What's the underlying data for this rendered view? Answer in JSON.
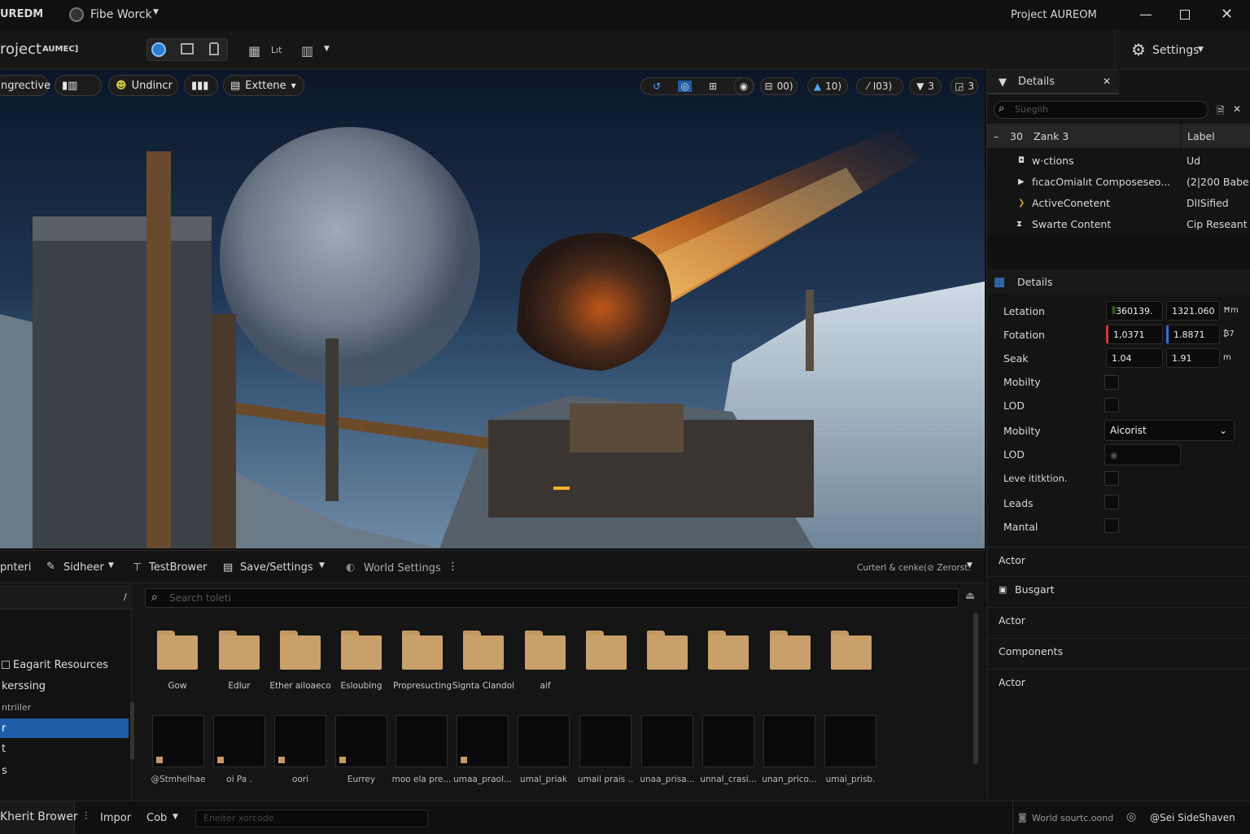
{
  "titlebar": {
    "app_name": "UREDM",
    "menu": "Fibe Worck",
    "project": "Project AUREOM"
  },
  "toolbar": {
    "project_label": "roject",
    "project_tag": "AUMEC]",
    "settings": "Settings"
  },
  "viewport": {
    "chips": [
      "ngrective",
      "Undincr",
      "Exttene"
    ],
    "stats": [
      "00)",
      "10)",
      "I03)",
      "3",
      "3"
    ]
  },
  "outliner": {
    "panel_title": "Details",
    "search_placeholder": "Suegiih",
    "header": {
      "num": "30",
      "name": "Zank 3",
      "col": "Label"
    },
    "rows": [
      {
        "name": "w·ctions",
        "value": "Ud"
      },
      {
        "name": "fıcacOmialıt Composeseo...",
        "value": "(2|200 Babe"
      },
      {
        "name": "ActiveConetent",
        "value": "DlISified"
      },
      {
        "name": "Swarte Content",
        "value": "Cip Reseant"
      }
    ]
  },
  "details": {
    "title": "Details",
    "location": {
      "label": "Letation",
      "x": "360139.",
      "y": "1321.060",
      "unit": "Ħm"
    },
    "rotation": {
      "label": "Fotation",
      "x": "1,0371",
      "y": "1.8871",
      "unit": "₿7"
    },
    "scale": {
      "label": "Seak",
      "x": "1.04",
      "y": "1.91",
      "unit": "m"
    },
    "props": [
      {
        "label": "Mobilty"
      },
      {
        "label": "LOD"
      },
      {
        "label": "Mobilty",
        "dropdown": "Aicorist"
      },
      {
        "label": "LOD"
      },
      {
        "label": "Leve ititktion."
      },
      {
        "label": "Leads"
      },
      {
        "label": "Mantal"
      }
    ],
    "sections": [
      "Actor",
      "Busgart",
      "Actor",
      "Components",
      "Actor"
    ]
  },
  "bottom": {
    "tabs": [
      "pnteri",
      "Sidheer",
      "TestBrower",
      "Save/Settings",
      "World Settings"
    ],
    "right_text": "Curterl & cenke(⊘ Zerorst.",
    "search_placeholder": "Search toleti",
    "tree": [
      "Eagarit Resources",
      "kerssing",
      "ntriiler",
      "r",
      "t",
      "s"
    ],
    "folders": [
      "Gow",
      "Edlur",
      "Ether ailoaeco",
      "Esloubing",
      "Propresucting",
      "Signta Clandol",
      "aif",
      "",
      "",
      "",
      "",
      ""
    ],
    "assets": [
      "@Stmhelhae",
      "oi Pa .",
      "oori",
      "Eurrey",
      "moo ela pre...",
      "umaa_praol...",
      "umal_priak",
      "umail prais ..",
      "unaa_prisa...",
      "unnal_crasi...",
      "unan_prico...",
      "umai_prisb."
    ]
  },
  "status": {
    "left": "Kherit Brower",
    "import": "Impor",
    "cob": "Cob",
    "cmd_placeholder": "Eneiter xorcode",
    "world": "World sourtc.oond",
    "source": "@Sei SideShaven"
  },
  "colors": {
    "accent": "#1e5ea8",
    "folder": "#caa06a"
  }
}
